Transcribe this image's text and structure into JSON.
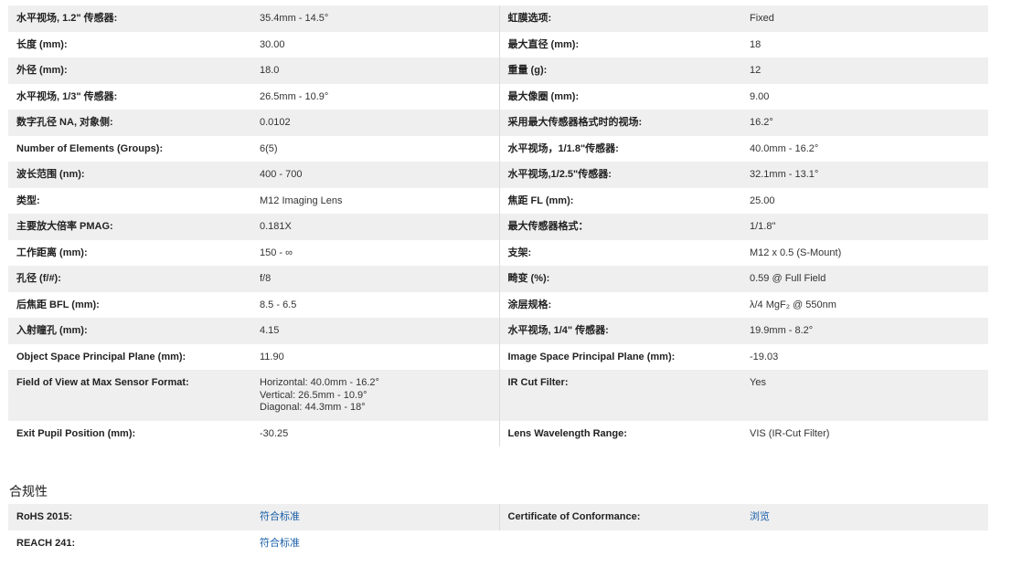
{
  "specs": [
    {
      "l1": "水平视场, 1.2\" 传感器:",
      "v1": "35.4mm - 14.5°",
      "l2": "虹膜选项:",
      "v2": "Fixed"
    },
    {
      "l1": "长度 (mm):",
      "v1": "30.00",
      "l2": "最大直径 (mm):",
      "v2": "18"
    },
    {
      "l1": "外径 (mm):",
      "v1": "18.0",
      "l2": "重量 (g):",
      "v2": "12"
    },
    {
      "l1": "水平视场, 1/3\" 传感器:",
      "v1": "26.5mm - 10.9°",
      "l2": "最大像圈 (mm):",
      "v2": "9.00"
    },
    {
      "l1": "数字孔径 NA, 对象侧:",
      "v1": "0.0102",
      "l2": "采用最大传感器格式时的视场:",
      "v2": "16.2°"
    },
    {
      "l1": "Number of Elements (Groups):",
      "v1": "6(5)",
      "l2": "水平视场，1/1.8\"传感器:",
      "v2": "40.0mm - 16.2°"
    },
    {
      "l1": "波长范围 (nm):",
      "v1": "400 - 700",
      "l2": "水平视场,1/2.5\"传感器:",
      "v2": "32.1mm - 13.1°"
    },
    {
      "l1": "类型:",
      "v1": "M12 Imaging Lens",
      "l2": "焦距 FL (mm):",
      "v2": "25.00"
    },
    {
      "l1": "主要放大倍率 PMAG:",
      "v1": "0.181X",
      "l2": "最大传感器格式：",
      "v2": "1/1.8\""
    },
    {
      "l1": "工作距离 (mm):",
      "v1": "150 - ∞",
      "l2": "支架:",
      "v2": "M12 x 0.5 (S-Mount)"
    },
    {
      "l1": "孔径 (f/#):",
      "v1": "f/8",
      "l2": "畸变 (%):",
      "v2": "0.59 @ Full Field"
    },
    {
      "l1": "后焦距 BFL (mm):",
      "v1": "8.5 - 6.5",
      "l2": "涂层规格:",
      "v2": "λ/4 MgF₂ @ 550nm"
    },
    {
      "l1": "入射瞳孔 (mm):",
      "v1": "4.15",
      "l2": "水平视场, 1/4\" 传感器:",
      "v2": "19.9mm - 8.2°"
    },
    {
      "l1": "Object Space Principal Plane (mm):",
      "v1": "11.90",
      "l2": "Image Space Principal Plane (mm):",
      "v2": "-19.03"
    },
    {
      "l1": "Field of View at Max Sensor Format:",
      "v1a": "Horizontal: 40.0mm - 16.2°",
      "v1b": "Vertical: 26.5mm - 10.9°",
      "v1c": "Diagonal: 44.3mm - 18°",
      "l2": "IR Cut Filter:",
      "v2": "Yes"
    },
    {
      "l1": "Exit Pupil Position (mm):",
      "v1": "-30.25",
      "l2": "Lens Wavelength Range:",
      "v2": "VIS (IR-Cut Filter)"
    }
  ],
  "compliance": {
    "heading": "合规性",
    "rows": [
      {
        "l1": "RoHS 2015:",
        "v1": "符合标准",
        "l2": "Certificate of Conformance:",
        "v2": "浏览"
      },
      {
        "l1": "REACH 241:",
        "v1": "符合标准"
      }
    ]
  },
  "colors": {
    "link": "#1a5fa8",
    "stripe": "#efefef"
  }
}
